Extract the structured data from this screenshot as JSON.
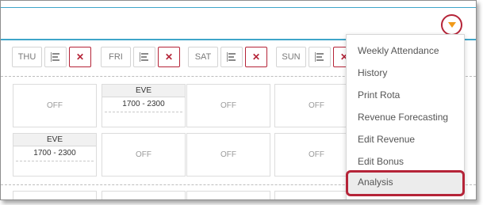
{
  "header": {
    "menu_toggle_icon": "triangle-down-icon",
    "accent": "#3ea5c9",
    "highlight": "#b52438",
    "toggle_color": "#f09a1a"
  },
  "days": [
    {
      "name": "THU",
      "list_icon": "list-icon",
      "remove_label": "✕"
    },
    {
      "name": "FRI",
      "list_icon": "list-icon",
      "remove_label": "✕"
    },
    {
      "name": "SAT",
      "list_icon": "list-icon",
      "remove_label": "✕"
    },
    {
      "name": "SUN",
      "list_icon": "list-icon",
      "remove_label": "✕"
    }
  ],
  "grid": {
    "row1": [
      {
        "type": "off",
        "text": "OFF"
      },
      {
        "type": "shift",
        "label": "EVE",
        "time": "1700 - 2300"
      },
      {
        "type": "off",
        "text": "OFF"
      },
      {
        "type": "off",
        "text": "OFF"
      }
    ],
    "row2": [
      {
        "type": "shift",
        "label": "EVE",
        "time": "1700 - 2300"
      },
      {
        "type": "off",
        "text": "OFF"
      },
      {
        "type": "off",
        "text": "OFF"
      },
      {
        "type": "off",
        "text": "OFF"
      }
    ]
  },
  "menu": {
    "items": [
      {
        "label": "Weekly Attendance"
      },
      {
        "label": "History"
      },
      {
        "label": "Print Rota"
      },
      {
        "label": "Revenue Forecasting"
      },
      {
        "label": "Edit Revenue"
      },
      {
        "label": "Edit Bonus"
      },
      {
        "label": "Analysis",
        "highlighted": true
      }
    ]
  }
}
